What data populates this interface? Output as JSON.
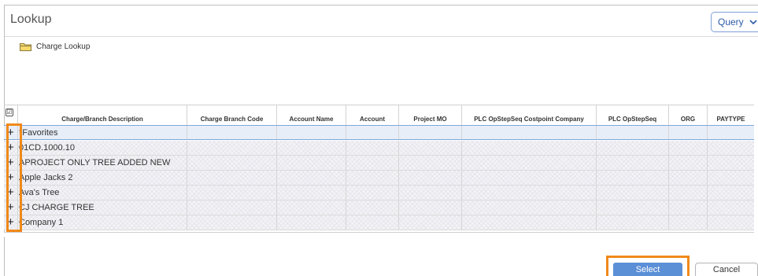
{
  "dialog": {
    "title": "Lookup",
    "query_label": "Query"
  },
  "tree": {
    "label": "Charge Lookup"
  },
  "grid": {
    "select_all_mark": "☑",
    "columns": [
      {
        "label": "Charge/Branch Description"
      },
      {
        "label": "Charge Branch Code"
      },
      {
        "label": "Account Name"
      },
      {
        "label": "Account"
      },
      {
        "label": "Project MO"
      },
      {
        "label": "PLC OpStepSeq Costpoint Company"
      },
      {
        "label": "PLC OpStepSeq"
      },
      {
        "label": "ORG"
      },
      {
        "label": "PAYTYPE"
      }
    ],
    "expand_glyph": "+",
    "rows": [
      {
        "description": "*Favorites"
      },
      {
        "description": "01CD.1000.10"
      },
      {
        "description": "APROJECT ONLY TREE ADDED NEW"
      },
      {
        "description": "Apple Jacks 2"
      },
      {
        "description": "Ava's Tree"
      },
      {
        "description": "CJ CHARGE TREE"
      },
      {
        "description": "Company 1"
      }
    ]
  },
  "footer": {
    "select_label": "Select",
    "cancel_label": "Cancel"
  },
  "colors": {
    "accent": "#5b8fd6",
    "highlight": "#f0891a",
    "favorite_row": "#e8eef8"
  }
}
